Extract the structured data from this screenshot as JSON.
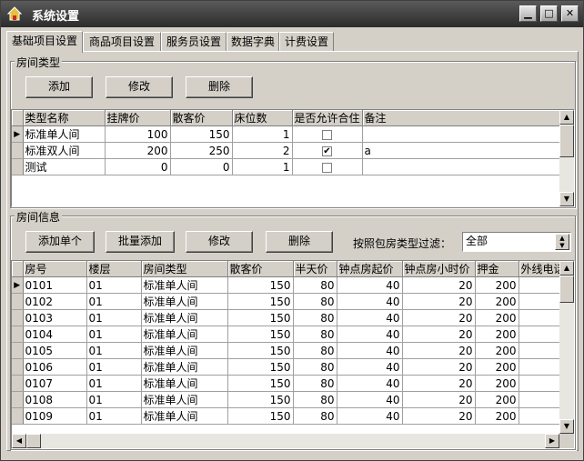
{
  "window": {
    "title": "系统设置",
    "min_icon": "minimize-icon",
    "max_icon": "maximize-icon",
    "close_icon": "close-icon"
  },
  "tabs": [
    {
      "label": "基础项目设置",
      "active": true
    },
    {
      "label": "商品项目设置",
      "active": false
    },
    {
      "label": "服务员设置",
      "active": false
    },
    {
      "label": "数据字典",
      "active": false
    },
    {
      "label": "计费设置",
      "active": false
    }
  ],
  "room_type": {
    "group_label": "房间类型",
    "buttons": {
      "add": "添加",
      "edit": "修改",
      "delete": "删除"
    },
    "columns": [
      "类型名称",
      "挂牌价",
      "散客价",
      "床位数",
      "是否允许合住",
      "备注"
    ],
    "rows": [
      {
        "name": "标准单人间",
        "list_price": "100",
        "walkin_price": "150",
        "beds": "1",
        "share": false,
        "note": ""
      },
      {
        "name": "标准双人间",
        "list_price": "200",
        "walkin_price": "250",
        "beds": "2",
        "share": true,
        "note": "a"
      },
      {
        "name": "测试",
        "list_price": "0",
        "walkin_price": "0",
        "beds": "1",
        "share": false,
        "note": ""
      }
    ]
  },
  "room_info": {
    "group_label": "房间信息",
    "buttons": {
      "add_single": "添加单个",
      "batch_add": "批量添加",
      "edit": "修改",
      "delete": "删除"
    },
    "filter_label": "按照包房类型过滤：",
    "filter_value": "全部",
    "columns": [
      "房号",
      "楼层",
      "房间类型",
      "散客价",
      "半天价",
      "钟点房起价",
      "钟点房小时价",
      "押金",
      "外线电话"
    ],
    "rows": [
      [
        "0101",
        "01",
        "标准单人间",
        "150",
        "80",
        "40",
        "20",
        "200"
      ],
      [
        "0102",
        "01",
        "标准单人间",
        "150",
        "80",
        "40",
        "20",
        "200"
      ],
      [
        "0103",
        "01",
        "标准单人间",
        "150",
        "80",
        "40",
        "20",
        "200"
      ],
      [
        "0104",
        "01",
        "标准单人间",
        "150",
        "80",
        "40",
        "20",
        "200"
      ],
      [
        "0105",
        "01",
        "标准单人间",
        "150",
        "80",
        "40",
        "20",
        "200"
      ],
      [
        "0106",
        "01",
        "标准单人间",
        "150",
        "80",
        "40",
        "20",
        "200"
      ],
      [
        "0107",
        "01",
        "标准单人间",
        "150",
        "80",
        "40",
        "20",
        "200"
      ],
      [
        "0108",
        "01",
        "标准单人间",
        "150",
        "80",
        "40",
        "20",
        "200"
      ],
      [
        "0109",
        "01",
        "标准单人间",
        "150",
        "80",
        "40",
        "20",
        "200"
      ]
    ]
  }
}
